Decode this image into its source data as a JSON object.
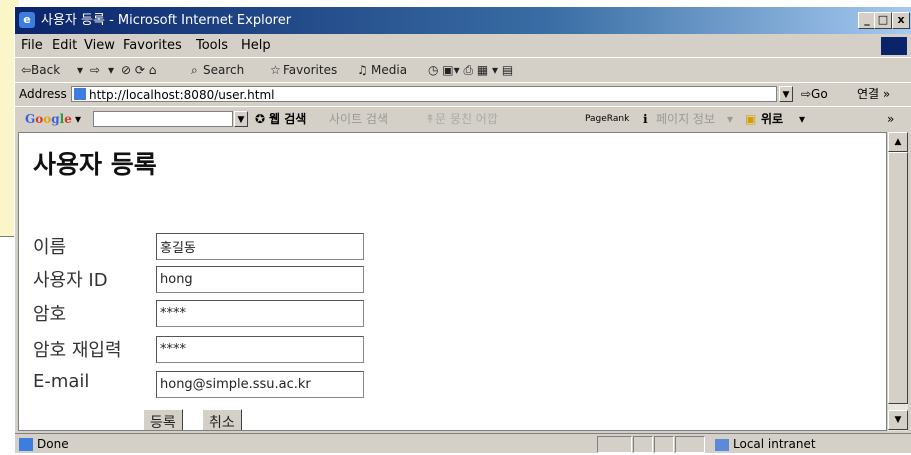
{
  "window": {
    "title": "사용자 등록 - Microsoft Internet Explorer",
    "controls": [
      "_",
      "□",
      "x"
    ]
  },
  "menu": [
    "File",
    "Edit",
    "View",
    "Favorites",
    "Tools",
    "Help"
  ],
  "toolbar": {
    "back": "⇦Back",
    "back_dd": "▾",
    "forward": "⇨",
    "forward_dd": "▾",
    "icons": "⊘ ⟳ ⌂",
    "search": "Search",
    "favorites": "Favorites",
    "media": "Media",
    "tail": "◷ ▣▾ ⎙ ▦ ▾ ▤"
  },
  "address": {
    "label": "Address",
    "url": "http://localhost:8080/user.html",
    "go": "⇨Go",
    "links": "연결 »"
  },
  "google": {
    "logo": "Google",
    "logo_dd": "▾",
    "search_web": "웹 검색",
    "search_site": "사이트 검색",
    "pagerank": "PageRank",
    "page_info": "페이지 정보",
    "page_info_dd": "▾",
    "up": "위로",
    "up_dd": "▾",
    "more": "»",
    "faded_buttons": "↟문 뭉친 어깝"
  },
  "page": {
    "title": "사용자 등록",
    "labels": {
      "name": "이름",
      "user_id": "사용자 ID",
      "password": "암호",
      "password_confirm": "암호 재입력",
      "email": "E-mail"
    },
    "values": {
      "name": "홍길동",
      "user_id": "hong",
      "password": "****",
      "password_confirm": "****",
      "email": "hong@simple.ssu.ac.kr"
    },
    "buttons": {
      "submit": "등록",
      "cancel": "취소"
    }
  },
  "status": {
    "text": "Done",
    "zone": "Local intranet"
  }
}
